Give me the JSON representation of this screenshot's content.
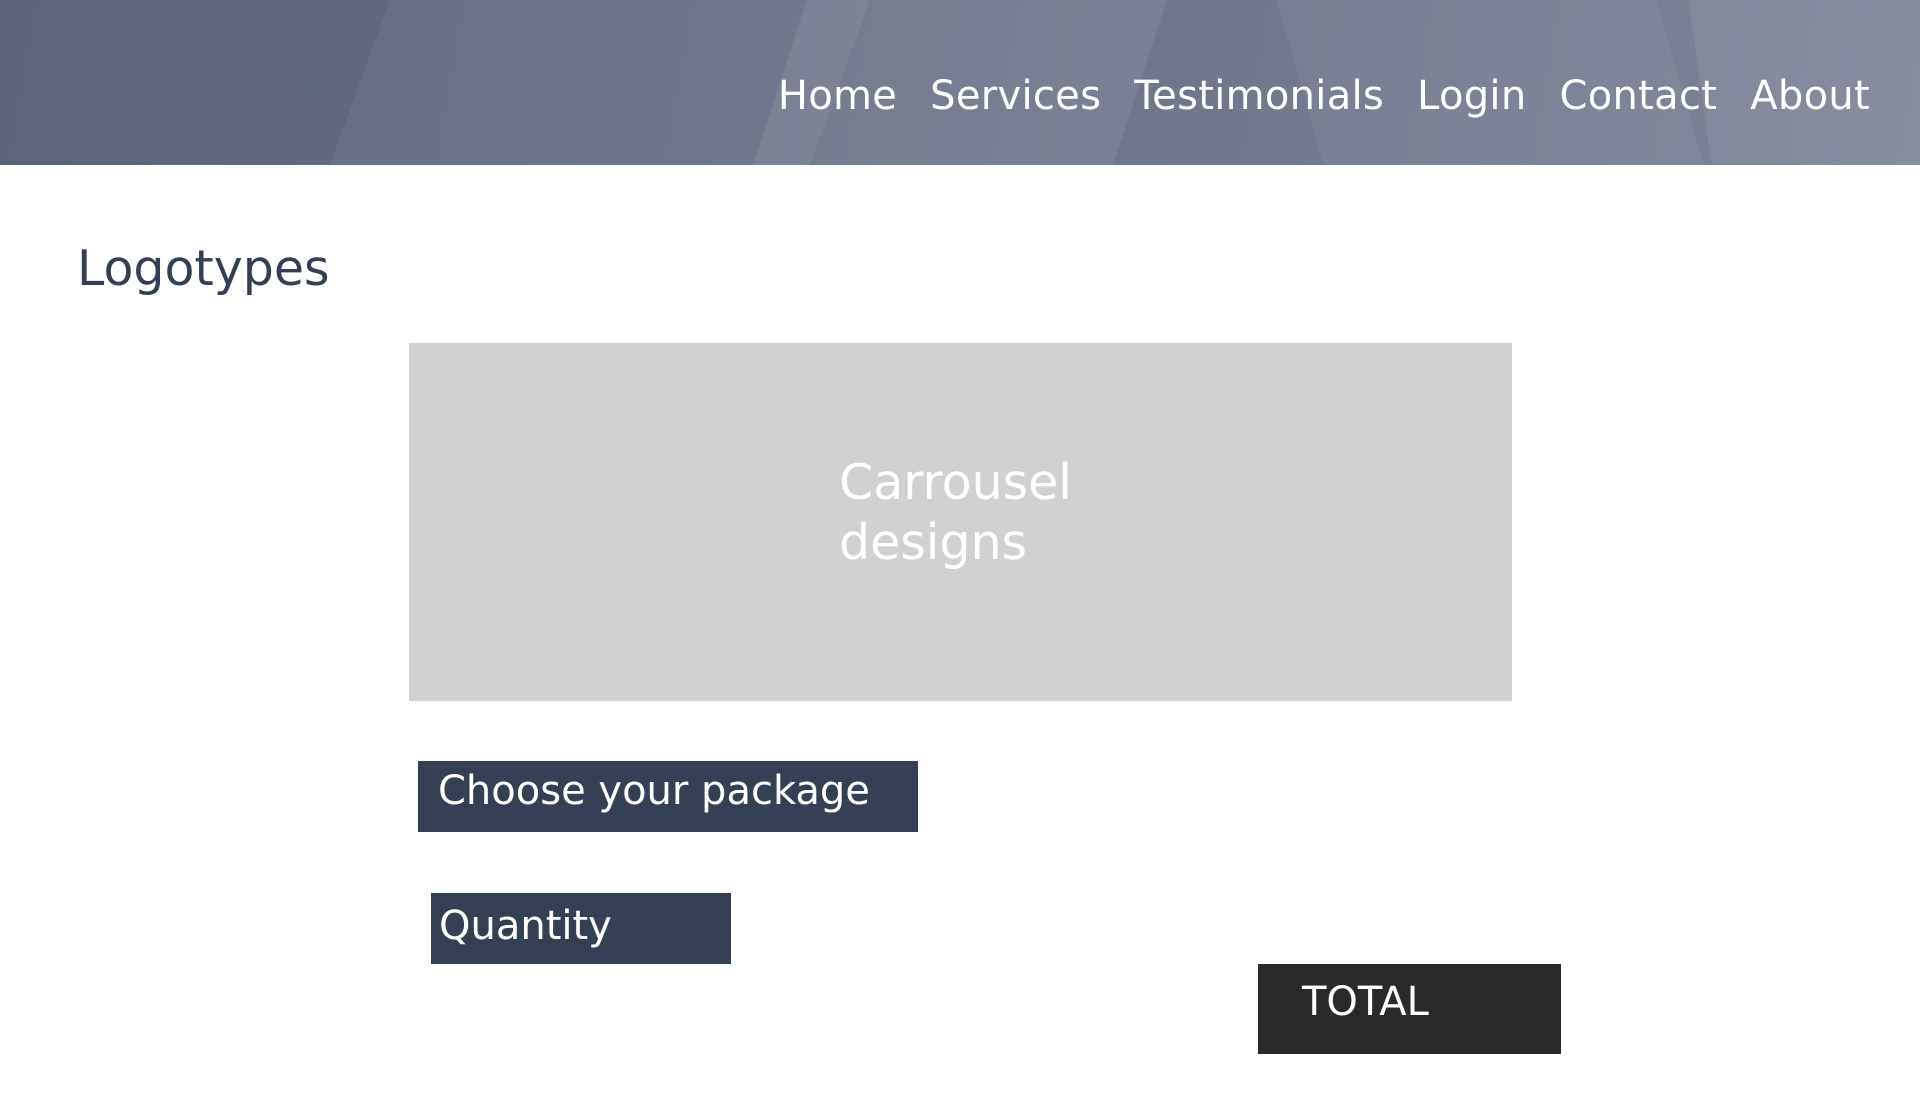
{
  "header": {
    "nav": [
      {
        "label": "Home"
      },
      {
        "label": "Services"
      },
      {
        "label": "Testimonials"
      },
      {
        "label": "Login"
      },
      {
        "label": "Contact"
      },
      {
        "label": "About"
      }
    ]
  },
  "main": {
    "title": "Logotypes",
    "carousel": {
      "line1": "Carrousel",
      "line2": "designs"
    },
    "package_button": "Choose your package",
    "quantity_button": "Quantity",
    "total_label": "TOTAL"
  },
  "colors": {
    "header_overlay": "#646b80",
    "title_text": "#343f55",
    "carousel_bg": "#d2d1d2",
    "button_bg": "#364055",
    "total_bg": "#292a2b"
  }
}
